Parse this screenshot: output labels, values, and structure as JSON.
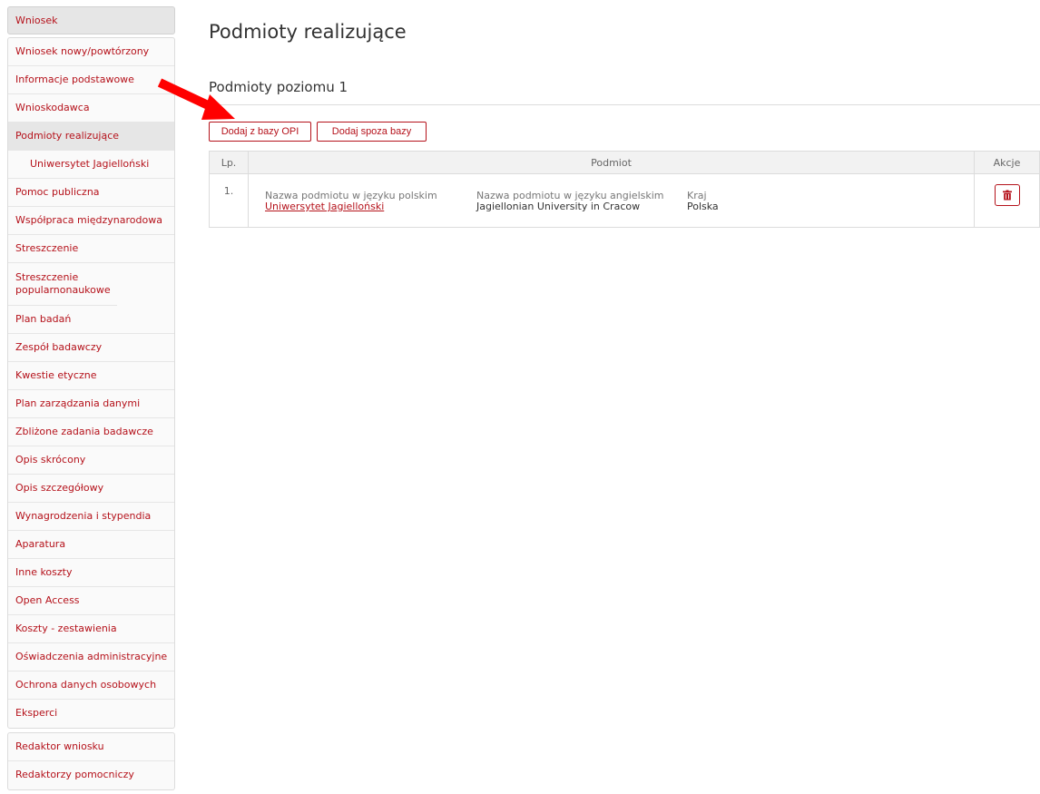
{
  "sidebar": {
    "header": "Wniosek",
    "items": [
      {
        "label": "Wniosek nowy/powtórzony"
      },
      {
        "label": "Informacje podstawowe"
      },
      {
        "label": "Wnioskodawca"
      },
      {
        "label": "Podmioty realizujące"
      },
      {
        "label": "Uniwersytet Jagielloński"
      },
      {
        "label": "Pomoc publiczna"
      },
      {
        "label": "Współpraca międzynarodowa"
      },
      {
        "label": "Streszczenie"
      },
      {
        "label": "Streszczenie popularnonaukowe"
      },
      {
        "label": "Plan badań"
      },
      {
        "label": "Zespół badawczy"
      },
      {
        "label": "Kwestie etyczne"
      },
      {
        "label": "Plan zarządzania danymi"
      },
      {
        "label": "Zbliżone zadania badawcze"
      },
      {
        "label": "Opis skrócony"
      },
      {
        "label": "Opis szczegółowy"
      },
      {
        "label": "Wynagrodzenia i stypendia"
      },
      {
        "label": "Aparatura"
      },
      {
        "label": "Inne koszty"
      },
      {
        "label": "Open Access"
      },
      {
        "label": "Koszty - zestawienia"
      },
      {
        "label": "Oświadczenia administracyjne"
      },
      {
        "label": "Ochrona danych osobowych"
      },
      {
        "label": "Eksperci"
      }
    ],
    "group2": [
      {
        "label": "Redaktor wniosku"
      },
      {
        "label": "Redaktorzy pomocniczy"
      }
    ]
  },
  "main": {
    "title": "Podmioty realizujące",
    "section_title": "Podmioty poziomu 1",
    "add_from_db": "Dodaj z bazy OPI",
    "add_outside_db": "Dodaj spoza bazy",
    "table": {
      "headers": {
        "lp": "Lp.",
        "podmiot": "Podmiot",
        "akcje": "Akcje"
      },
      "rows": [
        {
          "lp": "1.",
          "name_pl_label": "Nazwa podmiotu w języku polskim",
          "name_pl": "Uniwersytet Jagielloński",
          "name_en_label": "Nazwa podmiotu w języku angielskim",
          "name_en": "Jagiellonian University in Cracow",
          "country_label": "Kraj",
          "country": "Polska"
        }
      ]
    }
  },
  "colors": {
    "accent": "#b5121b",
    "annotation_arrow": "#ff0000"
  },
  "icons": {
    "delete": "trash-icon",
    "annotation": "arrow-annotation-icon"
  }
}
